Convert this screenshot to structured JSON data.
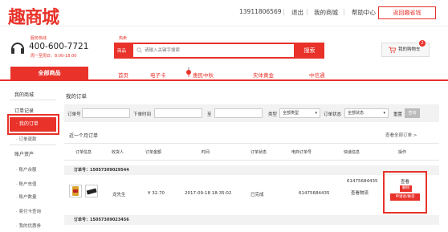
{
  "header": {
    "logo": "趣商城",
    "phone_user": "13911806569",
    "logout": "退出",
    "my_mall": "我的商城",
    "help": "帮助中心",
    "back_btn": "返回趣省钱",
    "separator": "|"
  },
  "service": {
    "label": "服务热线",
    "phone": "400-600-7721",
    "hours": "周一至周日：8:00-18:00"
  },
  "search": {
    "hot_label": "热卖",
    "category": "商品",
    "placeholder": "请输入关键字搜索",
    "button": "搜索",
    "cart_label": "我的购物车",
    "cart_count": "2"
  },
  "nav": {
    "all": "全部商品",
    "items": [
      "首页",
      "电子卡",
      "惠民中秋",
      "实体黄金",
      "中信通"
    ]
  },
  "sidebar": {
    "title": "我的商城",
    "sections": [
      {
        "label": "订单记录",
        "items": [
          "我的订单",
          "订单退款"
        ]
      },
      {
        "label": "账户资产",
        "items": [
          "账户余额",
          "账户充值",
          "账户数量",
          "易付卡查询",
          "我的优惠券"
        ]
      }
    ]
  },
  "main": {
    "title": "我的订单",
    "filter": {
      "order_no": "订单号",
      "order_time": "下单时间",
      "to": "至",
      "type": "类型",
      "type_value": "全部类型",
      "status": "订单状态",
      "status_value": "全部状态",
      "reset": "重置",
      "query": "查询"
    },
    "recent": "近一个月订单",
    "all_orders": "查看全部订单 >",
    "columns": [
      "订单信息",
      "收货人",
      "订单金额",
      "时间",
      "订单状态",
      "电商订单号",
      "快递信息",
      "操作"
    ],
    "orders": [
      {
        "order_no": "订单号：15057309029544",
        "receiver": "龙先生",
        "amount": "¥ 32.70",
        "time": "2017-09-18 18:35:02",
        "status": "已完成",
        "ec_no": "61475684435",
        "express_no": "61475684435",
        "express_link": "查看物流",
        "op_view": "查看",
        "op_cancel": "删除",
        "op_return": "申请退/换货"
      },
      {
        "order_no": "订单号：15057309023456"
      }
    ]
  },
  "colors": {
    "accent": "#e8322a"
  },
  "icons": [
    "headset-icon",
    "search-icon",
    "cart-icon",
    "lantern-icon"
  ]
}
